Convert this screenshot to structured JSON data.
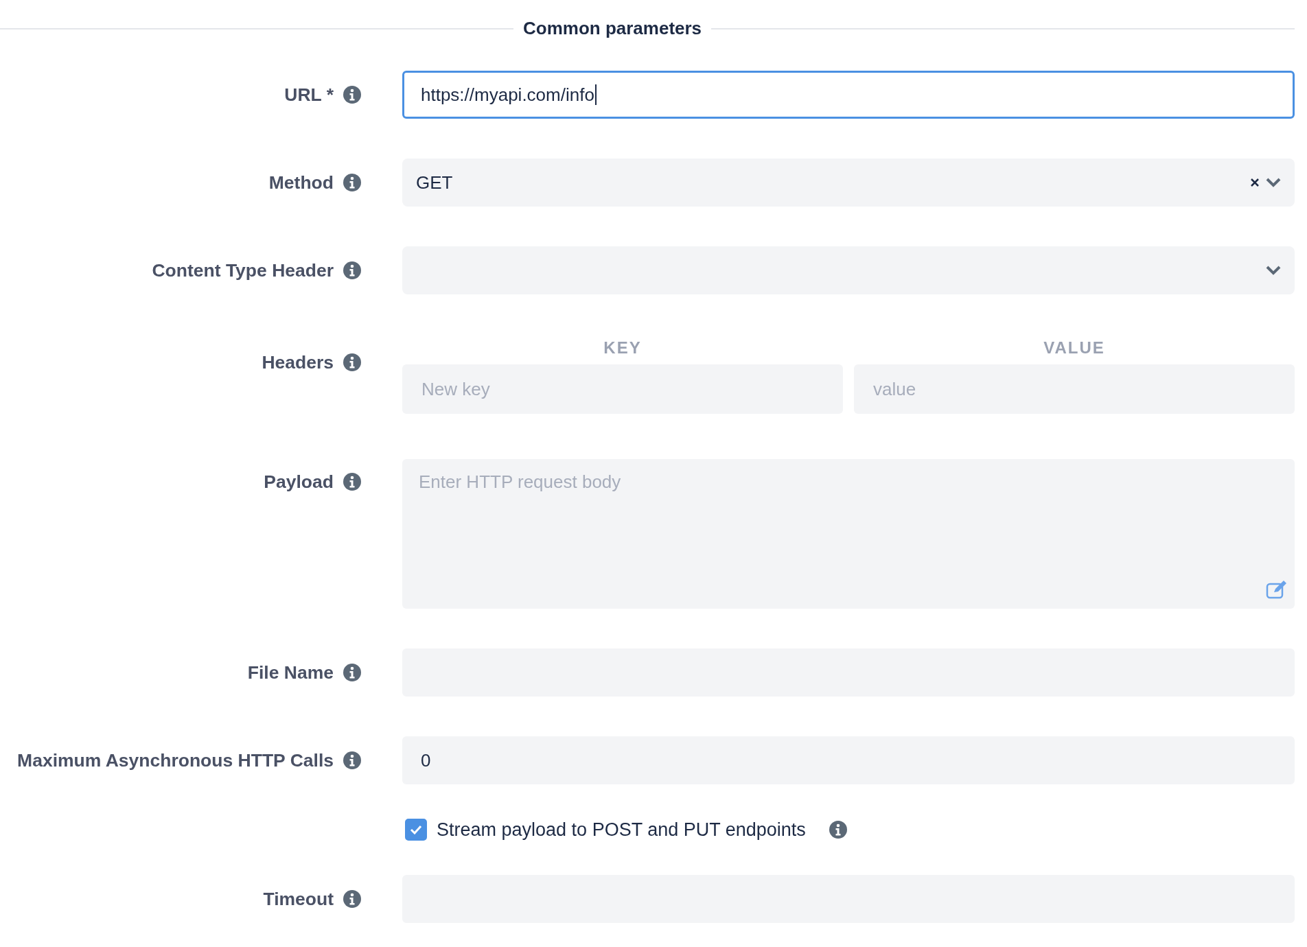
{
  "section_title": "Common parameters",
  "fields": [
    {
      "kind": "text",
      "label": "URL *",
      "value": "https://myapi.com/info",
      "focused": true
    },
    {
      "kind": "select",
      "label": "Method",
      "value": "GET",
      "clearable": true
    },
    {
      "kind": "select",
      "label": "Content Type Header",
      "clearable": false
    },
    {
      "kind": "keyvalue",
      "label": "Headers",
      "key_heading": "KEY",
      "value_heading": "VALUE",
      "key_placeholder": "New key",
      "value_placeholder": "value"
    },
    {
      "kind": "textarea",
      "label": "Payload",
      "placeholder": "Enter HTTP request body"
    },
    {
      "kind": "text",
      "label": "File Name",
      "focused": false
    },
    {
      "kind": "text",
      "label": "Maximum Asynchronous HTTP Calls",
      "value": "0",
      "focused": false
    },
    {
      "kind": "checkbox",
      "label": "Stream payload to POST and PUT endpoints",
      "checked": true
    },
    {
      "kind": "text",
      "label": "Timeout",
      "focused": false
    }
  ]
}
